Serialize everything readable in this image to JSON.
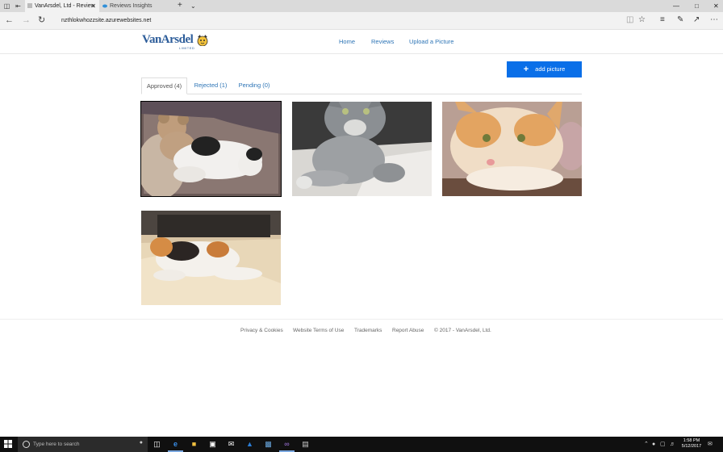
{
  "browser": {
    "tabs": [
      {
        "label": "VanArsdel, Ltd - Review",
        "active": true
      },
      {
        "label": "Reviews Insights",
        "active": false
      }
    ],
    "url": "nzthlokwhozzsite.azurewebsites.net",
    "icons": [
      "tab-preview-icon",
      "back-tabs-icon",
      "new-tab-icon",
      "tab-list-icon",
      "minimize-icon",
      "maximize-icon",
      "close-icon",
      "back-icon",
      "forward-icon",
      "refresh-icon",
      "reading-view-icon",
      "favorite-star-icon",
      "hub-icon",
      "pen-icon",
      "share-icon",
      "more-icon"
    ]
  },
  "site": {
    "logo_text": "VanArsdel",
    "logo_sub": "LIMITED",
    "nav": [
      "Home",
      "Reviews",
      "Upload a Picture"
    ],
    "add_button": "add picture",
    "tabs": [
      "Approved (4)",
      "Rejected (1)",
      "Pending (0)"
    ],
    "active_tab": 0,
    "photos": [
      {
        "subject": "cat sleeping with teddy bear",
        "selected": true
      },
      {
        "subject": "grey tabby cat lying",
        "selected": false
      },
      {
        "subject": "orange and white cat",
        "selected": false
      },
      {
        "subject": "calico cat sleeping",
        "selected": false
      }
    ]
  },
  "footer": {
    "links": [
      "Privacy & Cookies",
      "Website Terms of Use",
      "Trademarks",
      "Report Abuse"
    ],
    "copyright": "© 2017 - VanArsdel, Ltd."
  },
  "taskbar": {
    "search_placeholder": "Type here to search",
    "time": "1:58 PM",
    "date": "5/12/2017",
    "colors": {
      "taskbar": "#101010",
      "accent": "#0a6fe8"
    }
  }
}
